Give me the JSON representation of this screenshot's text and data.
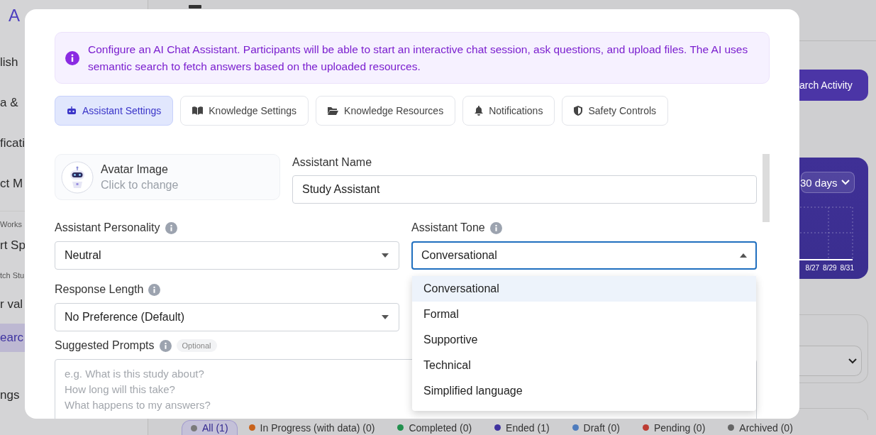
{
  "background": {
    "logo": "A",
    "sidebar": [
      {
        "label": "lish",
        "kind": "item",
        "selected": false
      },
      {
        "label": "a &",
        "kind": "item",
        "selected": false
      },
      {
        "label": "ficati",
        "kind": "item",
        "selected": false
      },
      {
        "label": "ct M",
        "kind": "item",
        "selected": false
      },
      {
        "label": "Works",
        "kind": "section",
        "selected": false
      },
      {
        "label": "rt Sp",
        "kind": "item",
        "selected": false
      },
      {
        "label": "tch Stu",
        "kind": "section",
        "selected": false
      },
      {
        "label": "r val",
        "kind": "item",
        "selected": false
      },
      {
        "label": "earc",
        "kind": "item",
        "selected": true
      },
      {
        "label": "ngs",
        "kind": "item",
        "selected": false
      }
    ],
    "activity_button": "arch Activity",
    "range_select": "30 days",
    "chart_ticks": [
      "8/27",
      "8/29",
      "8/31"
    ],
    "filters": [
      {
        "label": "All (1)",
        "color": "#7a7a7a",
        "selected": true
      },
      {
        "label": "In Progress (with data) (0)",
        "color": "#c8621a",
        "selected": false
      },
      {
        "label": "Completed (0)",
        "color": "#22904e",
        "selected": false
      },
      {
        "label": "Ended (1)",
        "color": "#40339f",
        "selected": false
      },
      {
        "label": "Draft (0)",
        "color": "#4f7cbd",
        "selected": false
      },
      {
        "label": "Pending (0)",
        "color": "#bd3c33",
        "selected": false
      },
      {
        "label": "Archived (0)",
        "color": "#656565",
        "selected": false
      }
    ]
  },
  "modal": {
    "banner": "Configure an AI Chat Assistant. Participants will be able to start an interactive chat session, ask questions, and upload files. The AI uses semantic search to fetch answers based on the uploaded resources.",
    "tabs": [
      {
        "label": "Assistant Settings",
        "selected": true
      },
      {
        "label": "Knowledge Settings",
        "selected": false
      },
      {
        "label": "Knowledge Resources",
        "selected": false
      },
      {
        "label": "Notifications",
        "selected": false
      },
      {
        "label": "Safety Controls",
        "selected": false
      }
    ],
    "avatar": {
      "title": "Avatar Image",
      "subtitle": "Click to change"
    },
    "name": {
      "label": "Assistant Name",
      "value": "Study Assistant"
    },
    "personality": {
      "label": "Assistant Personality",
      "value": "Neutral",
      "open": false
    },
    "tone": {
      "label": "Assistant Tone",
      "value": "Conversational",
      "open": true,
      "options": [
        {
          "label": "Conversational",
          "selected": true
        },
        {
          "label": "Formal",
          "selected": false
        },
        {
          "label": "Supportive",
          "selected": false
        },
        {
          "label": "Technical",
          "selected": false
        },
        {
          "label": "Simplified language",
          "selected": false
        }
      ]
    },
    "response_length": {
      "label": "Response Length",
      "value": "No Preference (Default)",
      "open": false
    },
    "prompts": {
      "label": "Suggested Prompts",
      "badge": "Optional",
      "placeholder": "e.g. What is this study about?\nHow long will this take?\nWhat happens to my answers?"
    }
  }
}
